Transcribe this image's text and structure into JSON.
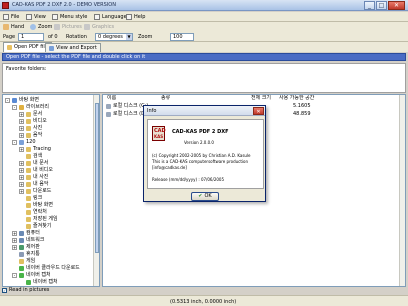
{
  "window": {
    "title": "CAD-KAS PDF 2 DXF 2.0 - DEMO VERSION",
    "minimize": "_",
    "maximize": "□",
    "close": "✕"
  },
  "menu": {
    "items": [
      {
        "label": "File",
        "icon": "file-icon"
      },
      {
        "label": "View",
        "icon": "view-icon"
      },
      {
        "label": "Menu style",
        "icon": "menu-style-icon"
      },
      {
        "label": "Language",
        "icon": "language-icon"
      },
      {
        "label": "Help",
        "icon": "help-icon"
      }
    ]
  },
  "toolbar": {
    "hand": "Hand",
    "zoom": "Zoom",
    "pictures": "Pictures",
    "graphics": "Graphics"
  },
  "nav": {
    "page_label": "Page",
    "page_value": "1",
    "of_label": "of 0",
    "rotation_label": "Rotation",
    "rotation_value": "0 degrees",
    "zoom_label": "Zoom",
    "zoom_value": "100"
  },
  "tabs": [
    {
      "label": "Open PDF file",
      "active": true
    },
    {
      "label": "View and Export",
      "active": false
    }
  ],
  "hint": "Open PDF file - select the PDF file and double click on it",
  "recent": {
    "label": "Favorite folders:"
  },
  "tree": {
    "items": [
      {
        "label": "바탕 화면",
        "level": 0,
        "toggle": "-",
        "color": "#5a8ad4"
      },
      {
        "label": "라이브러리",
        "level": 1,
        "toggle": "-",
        "color": "#e0b040"
      },
      {
        "label": "문서",
        "level": 2,
        "toggle": "+",
        "color": "#e0c060"
      },
      {
        "label": "비디오",
        "level": 2,
        "toggle": "+",
        "color": "#e0c060"
      },
      {
        "label": "사진",
        "level": 2,
        "toggle": "+",
        "color": "#e0c060"
      },
      {
        "label": "음악",
        "level": 2,
        "toggle": "+",
        "color": "#e0c060"
      },
      {
        "label": "120",
        "level": 1,
        "toggle": "-",
        "color": "#7aa0d8"
      },
      {
        "label": "Tracing",
        "level": 2,
        "toggle": "+",
        "color": "#e0c060"
      },
      {
        "label": "검색",
        "level": 2,
        "toggle": "",
        "color": "#e0c060"
      },
      {
        "label": "내 문서",
        "level": 2,
        "toggle": "+",
        "color": "#e0c060"
      },
      {
        "label": "내 비디오",
        "level": 2,
        "toggle": "+",
        "color": "#e0c060"
      },
      {
        "label": "내 사진",
        "level": 2,
        "toggle": "+",
        "color": "#e0c060"
      },
      {
        "label": "내 음악",
        "level": 2,
        "toggle": "+",
        "color": "#e0c060"
      },
      {
        "label": "다운로드",
        "level": 2,
        "toggle": "+",
        "color": "#e0c060"
      },
      {
        "label": "링크",
        "level": 2,
        "toggle": "",
        "color": "#e0c060"
      },
      {
        "label": "바탕 화면",
        "level": 2,
        "toggle": "",
        "color": "#e0c060"
      },
      {
        "label": "연락처",
        "level": 2,
        "toggle": "",
        "color": "#e0c060"
      },
      {
        "label": "저장된 게임",
        "level": 2,
        "toggle": "",
        "color": "#e0c060"
      },
      {
        "label": "즐겨찾기",
        "level": 2,
        "toggle": "",
        "color": "#e0c060"
      },
      {
        "label": "컴퓨터",
        "level": 1,
        "toggle": "+",
        "color": "#6a8ab4"
      },
      {
        "label": "네트워크",
        "level": 1,
        "toggle": "+",
        "color": "#6a8ab4"
      },
      {
        "label": "제어판",
        "level": 1,
        "toggle": "+",
        "color": "#4a9a6a"
      },
      {
        "label": "휴지통",
        "level": 1,
        "toggle": "",
        "color": "#8a9ab4"
      },
      {
        "label": "게임",
        "level": 1,
        "toggle": "",
        "color": "#e0c060"
      },
      {
        "label": "네이버 클라우드 다운로드",
        "level": 1,
        "toggle": "",
        "color": "#4ab44a"
      },
      {
        "label": "네이버 캡처",
        "level": 1,
        "toggle": "-",
        "color": "#4ab44a"
      },
      {
        "label": "네이버 캡처",
        "level": 2,
        "toggle": "",
        "color": "#4ab44a"
      }
    ]
  },
  "filelist": {
    "headers": {
      "name": "이름",
      "col2": "종류",
      "col3": "전체 크기",
      "col4": "사용 가능한 공간"
    },
    "rows": [
      {
        "name": "로컬 디스크 (C:)",
        "size": "",
        "free": "5.1605"
      },
      {
        "name": "로컬 디스크 (D:)",
        "size": "",
        "free": "48.859"
      }
    ]
  },
  "checkbar": {
    "checked": true,
    "label": "Read in pictures"
  },
  "status": {
    "text": "(0.5313 inch, 0.0000 inch)"
  },
  "dialog": {
    "title": "Info",
    "close": "✕",
    "logo_line1": "CAD",
    "logo_line2": "KAS",
    "product": "CAD-KAS PDF 2 DXF",
    "version": "Version 2.0.0.0",
    "copyright": "(c) Copyright 2002-2005 by Christian A.D. Kasule",
    "production": "This is a CAD-KAS computersoftware production",
    "email": "[info@cadkas.de]",
    "release": "Release (mm/dd/yyyy) : 07/06/2005",
    "ok_label": "OK"
  },
  "colors": {
    "accent": "#4a6cc4",
    "window_bg": "#d4d0c8",
    "toolbar_bg": "#ece9d8"
  }
}
